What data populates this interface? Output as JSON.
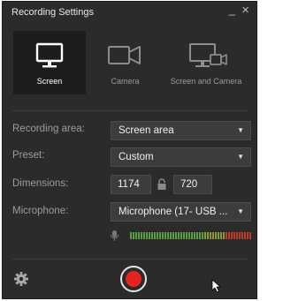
{
  "window": {
    "title": "Recording Settings",
    "minimize_glyph": "_",
    "close_glyph": "×"
  },
  "modes": [
    {
      "label": "Screen",
      "icon": "monitor-icon",
      "active": true
    },
    {
      "label": "Camera",
      "icon": "camera-icon",
      "active": false
    },
    {
      "label": "Screen and Camera",
      "icon": "monitor-camera-icon",
      "active": false
    }
  ],
  "settings": {
    "recording_area": {
      "label": "Recording area:",
      "value": "Screen area"
    },
    "preset": {
      "label": "Preset:",
      "value": "Custom"
    },
    "dimensions": {
      "label": "Dimensions:",
      "width": "1174",
      "height": "720"
    },
    "microphone": {
      "label": "Microphone:",
      "value": "Microphone (17- USB ..."
    }
  },
  "colors": {
    "background": "#2b2b2b",
    "active_mode_bg": "#1d1d1d",
    "record_red": "#e8231f",
    "meter_green": "#5aa03a",
    "meter_red": "#c0392b"
  }
}
